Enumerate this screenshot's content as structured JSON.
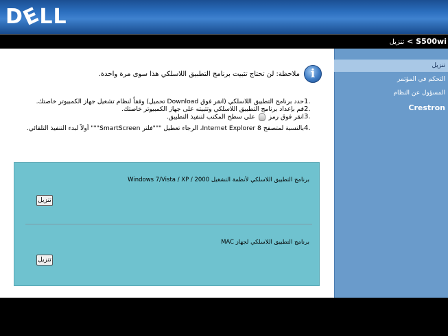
{
  "header": {
    "logo_text_d": "D",
    "logo_text_e": "E",
    "logo_text_ll": "LL"
  },
  "breadcrumb": {
    "product": "S500wi",
    "separator": " < ",
    "current": "تنزيل"
  },
  "sidebar": {
    "items": [
      {
        "label": "تنزيل",
        "active": true
      },
      {
        "label": "التحكم في المؤتمر",
        "active": false
      },
      {
        "label": "المسؤول عن النظام",
        "active": false
      },
      {
        "label": "Crestron",
        "active": false
      }
    ]
  },
  "note": {
    "icon": "info-icon",
    "icon_glyph": "i",
    "text": "ملاحظة: لن تحتاج تثبيت برنامج التطبيق اللاسلكي هذا سوى مرة واحدة."
  },
  "steps": [
    {
      "num": "1.",
      "text": "حدد برنامج التطبيق اللاسلكي (انقر فوق Download تحميل) وفقاً لنظام تشغيل جهاز الكمبيوتر خاصتك."
    },
    {
      "num": "2.",
      "text": "قم بإعداد برنامج التطبيق اللاسلكي وتثبيته على جهاز الكمبيوتر خاصتك."
    },
    {
      "num": "3.",
      "text_before": "انقر فوق رمز",
      "text_after": "على سطح المكتب لتنفيذ التطبيق."
    },
    {
      "num": "4.",
      "text": "بالنسبة لمتصفح Internet Explorer 8، الرجاء تعطيل \"\"\"فلتر SmartScreen\"\"\" أولاً لبدء التنفيذ التلقائي."
    }
  ],
  "panel": {
    "windows_label": "برنامج التطبيق اللاسلكي لأنظمة التشغيل Windows 7/Vista / XP / 2000",
    "windows_button": "تنزيل",
    "mac_label": "برنامج التطبيق اللاسلكي لجهاز MAC",
    "mac_button": "تنزيل"
  },
  "colors": {
    "header_blue": "#2c6fbf",
    "sidebar_blue": "#6a9bcb",
    "sidebar_active": "#a9c8e6",
    "panel_teal": "#6fc2cf"
  }
}
